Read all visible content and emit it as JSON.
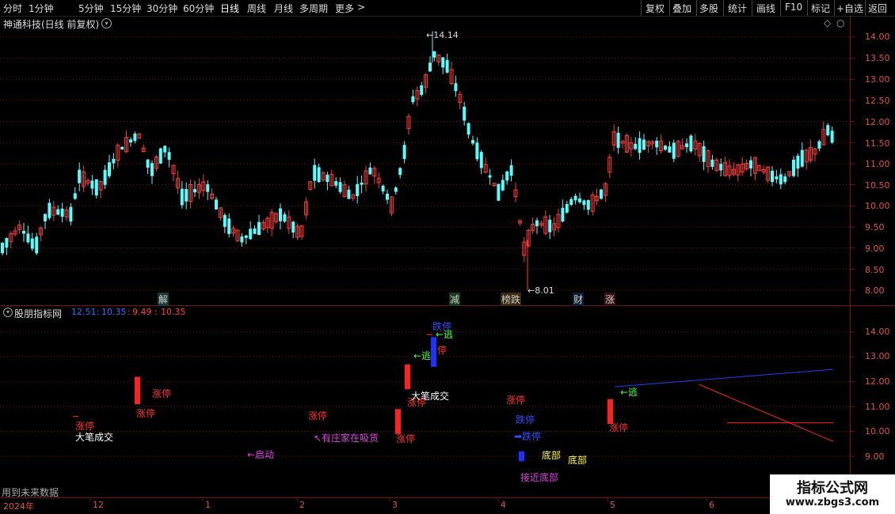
{
  "toolbar": {
    "periods": [
      "分时",
      "1分钟",
      "5分钟",
      "15分钟",
      "30分钟",
      "60分钟",
      "日线",
      "周线",
      "月线",
      "多周期",
      "更多"
    ],
    "active_period": "日线",
    "more_arrow": ">",
    "actions": [
      "复权",
      "叠加",
      "多股",
      "统计",
      "画线",
      "F10",
      "标记",
      "+自选",
      "返回"
    ]
  },
  "main_chart": {
    "title": "神通科技(日线 前复权)",
    "title_toggle_icon": "circle-chevron-down-icon",
    "corner_icons": [
      "diamond-icon",
      "circle-icon"
    ],
    "high_label": "14.14",
    "low_label": "8.01",
    "y_axis_labels": [
      "14.00",
      "13.50",
      "13.00",
      "12.50",
      "12.00",
      "11.50",
      "11.00",
      "10.50",
      "10.00",
      "9.50",
      "9.00",
      "8.50",
      "8.00"
    ],
    "events": [
      {
        "text": "解",
        "color": "#2fd0d0"
      },
      {
        "text": "减",
        "color": "#40d040"
      },
      {
        "text": "榜跌",
        "color": "#ff9030"
      },
      {
        "text": "财",
        "color": "#70b0ff"
      },
      {
        "text": "涨",
        "color": "#ff4040"
      }
    ],
    "colors": {
      "up": "#ff3c3c",
      "down": "#54ffff",
      "background": "#000000",
      "grid": "#7a1010"
    }
  },
  "indicator": {
    "title": "股朋指标网",
    "values": [
      "12.51",
      "10.35",
      "9.49",
      "10.35"
    ],
    "value_colors": [
      "#2f6fff",
      "#2f6fff",
      "#ff4040",
      "#ff4040"
    ],
    "y_axis_labels": [
      "14.00",
      "13.00",
      "12.00",
      "11.00",
      "10.00",
      "9.00"
    ],
    "annotations": [
      {
        "text": "涨停",
        "color": "#ff3030"
      },
      {
        "text": "大笔成交",
        "color": "#ffffff"
      },
      {
        "text": "涨停",
        "color": "#ff3030"
      },
      {
        "text": "涨停",
        "color": "#ff3030"
      },
      {
        "text": "←启动",
        "color": "#e040e0"
      },
      {
        "text": "涨停",
        "color": "#ff3030"
      },
      {
        "text": "↖有庄家在吸货",
        "color": "#e040e0"
      },
      {
        "text": "涨停",
        "color": "#ff3030"
      },
      {
        "text": "涨停",
        "color": "#ff3030"
      },
      {
        "text": "大笔成交",
        "color": "#ffffff"
      },
      {
        "text": "←逃",
        "color": "#40ff40"
      },
      {
        "text": "跌停",
        "color": "#3050ff"
      },
      {
        "text": "←逃",
        "color": "#40ff40"
      },
      {
        "text": "停",
        "color": "#ff3030"
      },
      {
        "text": "涨停",
        "color": "#ff3030"
      },
      {
        "text": "跌停",
        "color": "#3050ff"
      },
      {
        "text": "➡跌停",
        "color": "#3050ff"
      },
      {
        "text": "底部",
        "color": "#ffff40"
      },
      {
        "text": "底部",
        "color": "#ffff40"
      },
      {
        "text": "接近底部",
        "color": "#e040e0"
      },
      {
        "text": "←逃",
        "color": "#40ff40"
      },
      {
        "text": "涨停",
        "color": "#ff3030"
      }
    ],
    "footer_note": "用到未来数据"
  },
  "date_axis": [
    "2024年",
    "12",
    "1",
    "2",
    "3",
    "4",
    "5",
    "6"
  ],
  "watermark": {
    "line1": "指标公式网",
    "line2": "www.zbgs3.com"
  }
}
